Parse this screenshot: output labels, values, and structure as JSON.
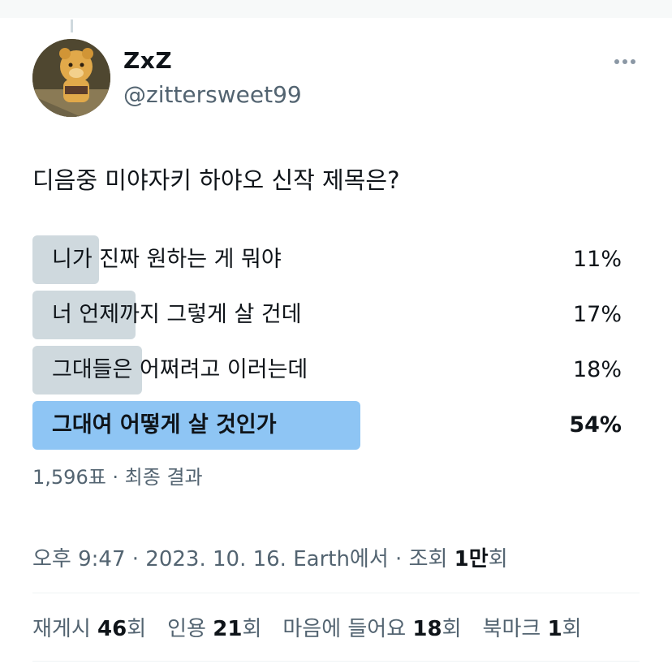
{
  "author": {
    "display_name": "ZxZ",
    "handle": "@zittersweet99"
  },
  "tweet": {
    "text": "디음중 미야자키 하야오 신작 제목은?"
  },
  "poll": {
    "options": [
      {
        "label": "니가 진짜 원하는 게 뭐야",
        "percent_text": "11%",
        "percent": 11
      },
      {
        "label": "너 언제까지 그렇게 살 건데",
        "percent_text": "17%",
        "percent": 17
      },
      {
        "label": "그대들은 어쩌려고 이러는데",
        "percent_text": "18%",
        "percent": 18
      },
      {
        "label": "그대여 어떻게 살 것인가",
        "percent_text": "54%",
        "percent": 54
      }
    ],
    "meta": "1,596표 · 최종 결과"
  },
  "timestamp": {
    "prefix": "오후 9:47 · 2023. 10. 16. Earth에서 · 조회 ",
    "views": "1만",
    "suffix": "회"
  },
  "stats": {
    "retweets": {
      "label": "재게시 ",
      "count": "46",
      "unit": "회"
    },
    "quotes": {
      "label": "인용 ",
      "count": "21",
      "unit": "회"
    },
    "likes": {
      "label": "마음에 들어요 ",
      "count": "18",
      "unit": "회"
    },
    "bookmarks": {
      "label": "북마크 ",
      "count": "1",
      "unit": "회"
    }
  },
  "colors": {
    "poll_bar": "#cfd9de",
    "poll_winner_bar": "#8ec5f4",
    "secondary_text": "#536471"
  }
}
